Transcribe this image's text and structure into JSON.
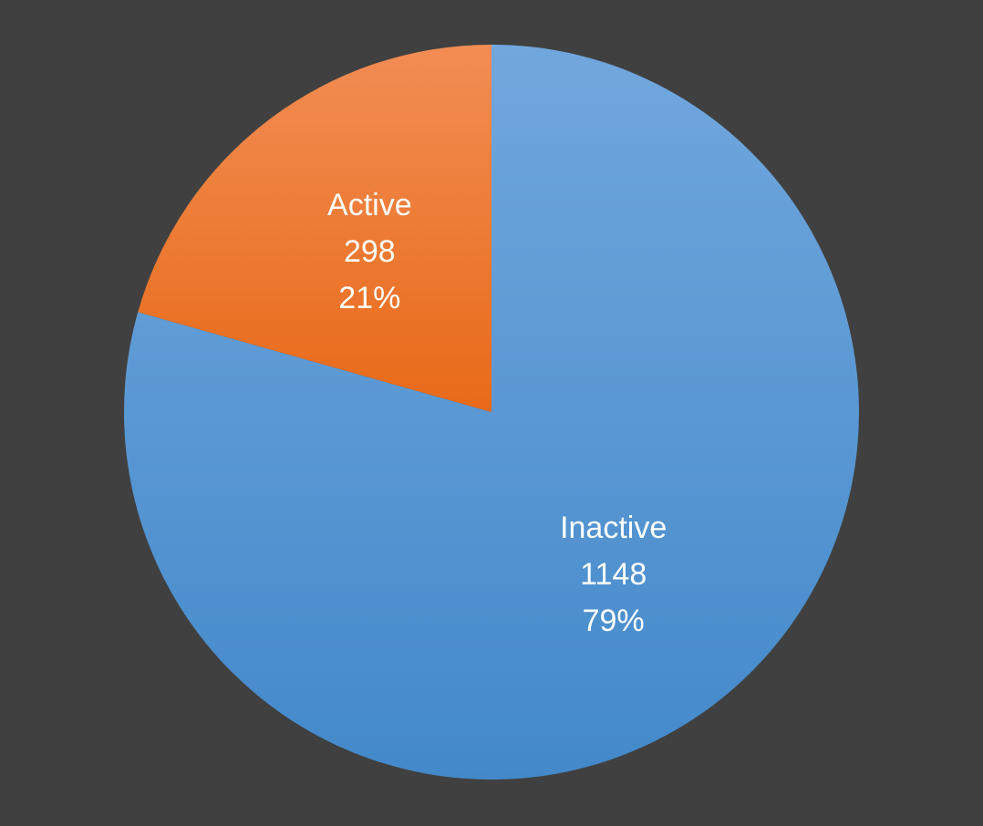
{
  "chart_data": {
    "type": "pie",
    "start_angle_deg": 0,
    "direction": "clockwise",
    "series": [
      {
        "values": [
          1148,
          298
        ]
      }
    ],
    "slices": [
      {
        "label": "Inactive",
        "value": 1148,
        "percent_label": "79%",
        "color": "#5B9BD5",
        "gradient": [
          "#71A7DD",
          "#4389CA"
        ]
      },
      {
        "label": "Active",
        "value": 298,
        "percent_label": "21%",
        "color": "#ED7D31",
        "gradient": [
          "#F28D54",
          "#E86A18"
        ]
      }
    ]
  },
  "colors": {
    "background": "#404040",
    "text": "#FFFFFF"
  }
}
